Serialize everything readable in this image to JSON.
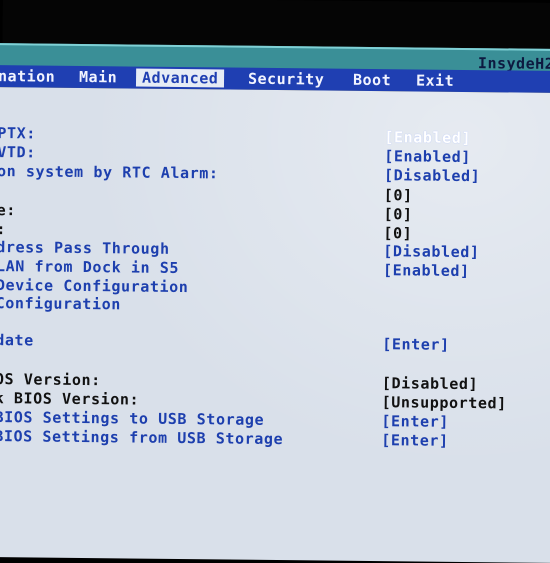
{
  "header": {
    "brand": "InsydeH2"
  },
  "tabs": [
    {
      "label": "nation"
    },
    {
      "label": "Main"
    },
    {
      "label": "Advanced"
    },
    {
      "label": "Security"
    },
    {
      "label": "Boot"
    },
    {
      "label": "Exit"
    }
  ],
  "rows": [
    {
      "label": "PTX:",
      "value": "[Enabled]"
    },
    {
      "label": "VTD:",
      "value": "[Enabled]"
    },
    {
      "label": "on system by RTC Alarm:",
      "value": "[Disabled]"
    },
    {
      "label": "",
      "value": "[0]"
    },
    {
      "label": "e:",
      "value": "[0]"
    },
    {
      "label": ":",
      "value": "[0]"
    },
    {
      "label": "dress Pass Through",
      "value": "[Disabled]"
    },
    {
      "label": "LAN from Dock in S5",
      "value": "[Enabled]"
    },
    {
      "label": "Device Configuration",
      "value": ""
    },
    {
      "label": "Configuration",
      "value": ""
    },
    {
      "label": "date",
      "value": "[Enter]"
    },
    {
      "label": "OS Version:",
      "value": "[Disabled]"
    },
    {
      "label": "k BIOS Version:",
      "value": "[Unsupported]"
    },
    {
      "label": "BIOS Settings to USB Storage",
      "value": "[Enter]"
    },
    {
      "label": "BIOS Settings from USB Storage",
      "value": "[Enter]"
    }
  ]
}
